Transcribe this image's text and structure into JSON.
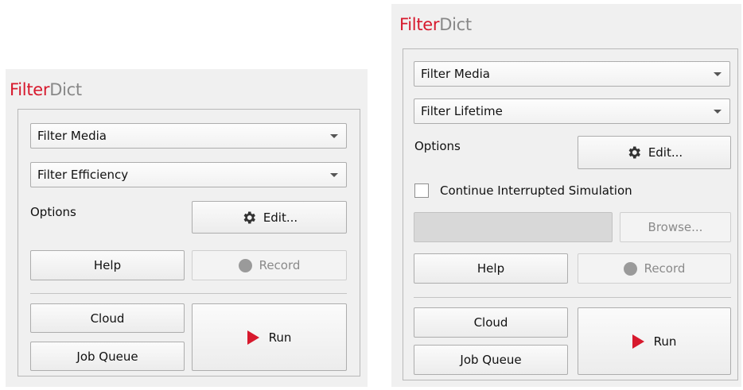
{
  "app": {
    "title_part1": "Filter",
    "title_part2": "Dict"
  },
  "left_panel": {
    "combo1": "Filter Media",
    "combo2": "Filter Efficiency",
    "options_label": "Options",
    "edit_button": "Edit...",
    "help_button": "Help",
    "record_button": "Record",
    "cloud_button": "Cloud",
    "job_queue_button": "Job Queue",
    "run_button": "Run"
  },
  "right_panel": {
    "combo1": "Filter Media",
    "combo2": "Filter Lifetime",
    "options_label": "Options",
    "edit_button": "Edit...",
    "continue_checkbox_label": "Continue Interrupted Simulation",
    "continue_checked": false,
    "path_value": "",
    "browse_button": "Browse...",
    "help_button": "Help",
    "record_button": "Record",
    "cloud_button": "Cloud",
    "job_queue_button": "Job Queue",
    "run_button": "Run"
  },
  "colors": {
    "accent_red": "#d7192d",
    "title_gray": "#888888",
    "panel_bg": "#f0f0f0"
  },
  "icons": [
    "gear-icon",
    "record-dot-icon",
    "play-icon",
    "dropdown-arrow-icon"
  ]
}
